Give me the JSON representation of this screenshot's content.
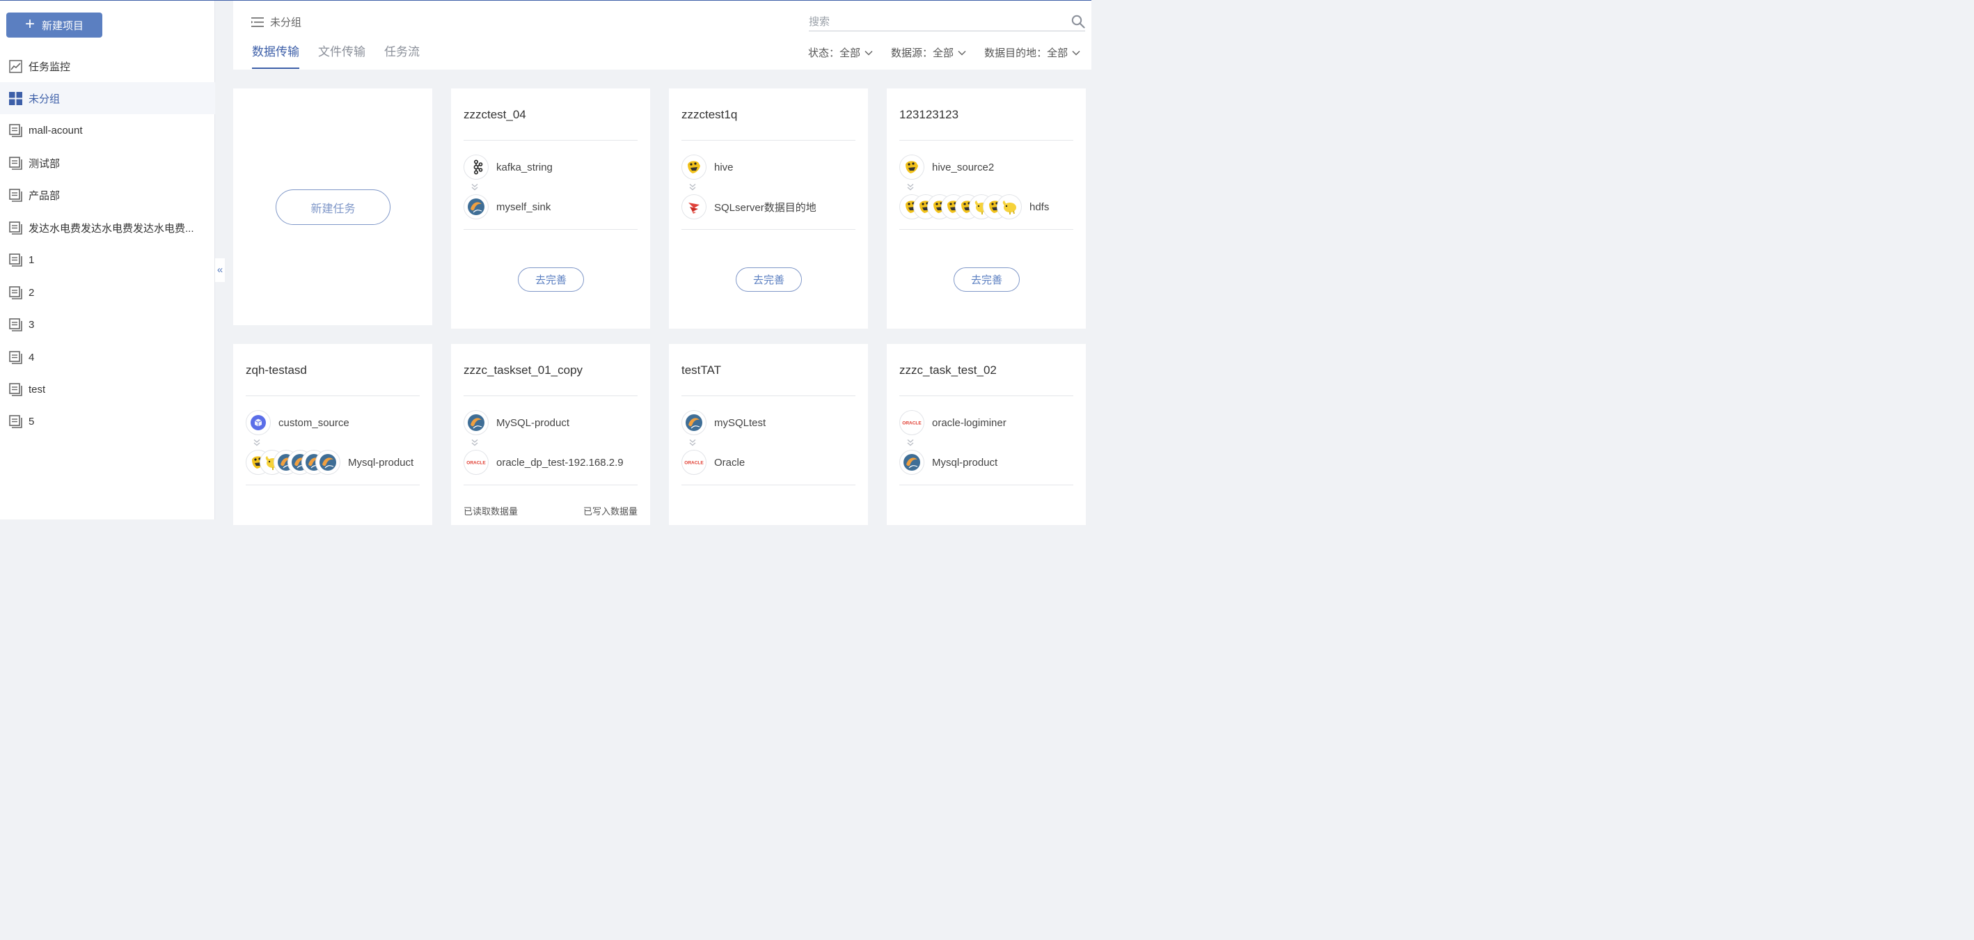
{
  "sidebar": {
    "new_project": "新建项目",
    "items": [
      {
        "label": "任务监控",
        "icon": "chart-icon"
      },
      {
        "label": "未分组",
        "icon": "grid-icon",
        "active": true
      },
      {
        "label": "mall-acount",
        "icon": "folder-icon"
      },
      {
        "label": "测试部",
        "icon": "folder-icon"
      },
      {
        "label": "产品部",
        "icon": "folder-icon"
      },
      {
        "label": "发达水电费发达水电费发达水电费...",
        "icon": "folder-icon"
      },
      {
        "label": "1",
        "icon": "folder-icon"
      },
      {
        "label": "2",
        "icon": "folder-icon"
      },
      {
        "label": "3",
        "icon": "folder-icon"
      },
      {
        "label": "4",
        "icon": "folder-icon"
      },
      {
        "label": "test",
        "icon": "folder-icon"
      },
      {
        "label": "5",
        "icon": "folder-icon"
      }
    ],
    "collapse": "«"
  },
  "header": {
    "group": "未分组",
    "tabs": [
      "数据传输",
      "文件传输",
      "任务流"
    ],
    "search_placeholder": "搜索",
    "filters": [
      {
        "label": "状态：",
        "value": "全部"
      },
      {
        "label": "数据源：",
        "value": "全部"
      },
      {
        "label": "数据目的地：",
        "value": "全部"
      }
    ]
  },
  "new_task": "新建任务",
  "perfect_label": "去完善",
  "cards": [
    {
      "title": "zzzctest_04",
      "source": {
        "label": "kafka_string",
        "icons": [
          "kafka-icon"
        ]
      },
      "target": {
        "label": "myself_sink",
        "icons": [
          "mysql-icon"
        ]
      }
    },
    {
      "title": "zzzctest1q",
      "source": {
        "label": "hive",
        "icons": [
          "hive-icon"
        ]
      },
      "target": {
        "label": "SQLserver数据目的地",
        "icons": [
          "sqlserver-icon"
        ]
      }
    },
    {
      "title": "123123123",
      "source": {
        "label": "hive_source2",
        "icons": [
          "hive-icon"
        ]
      },
      "target": {
        "label": "hdfs",
        "icons": [
          "hive-icon",
          "hive-icon",
          "hive-icon",
          "hive-icon",
          "hive-icon",
          "hadoop-icon",
          "hive-icon",
          "hadoop-icon"
        ]
      }
    },
    {
      "title": "zqh-testasd",
      "source": {
        "label": "custom_source",
        "icons": [
          "custom-icon"
        ]
      },
      "target": {
        "label": "Mysql-product",
        "icons": [
          "hive-icon",
          "hadoop-icon",
          "mysql-icon",
          "mysql-icon",
          "mysql-icon",
          "mysql-icon"
        ]
      }
    },
    {
      "title": "zzzc_taskset_01_copy",
      "source": {
        "label": "MySQL-product",
        "icons": [
          "mysql-icon"
        ]
      },
      "target": {
        "label": "oracle_dp_test-192.168.2.9",
        "icons": [
          "oracle-icon"
        ]
      }
    },
    {
      "title": "testTAT",
      "source": {
        "label": "mySQLtest",
        "icons": [
          "mysql-icon"
        ]
      },
      "target": {
        "label": "Oracle",
        "icons": [
          "oracle-icon"
        ]
      }
    },
    {
      "title": "zzzc_task_test_02",
      "source": {
        "label": "oracle-logiminer",
        "icons": [
          "oracle-icon"
        ]
      },
      "target": {
        "label": "Mysql-product",
        "icons": [
          "mysql-icon"
        ]
      }
    }
  ],
  "stats": {
    "read": "已读取数据量",
    "written": "已写入数据量"
  },
  "oracle_text": "ORACLE",
  "colors": {
    "accent": "#3d5fa8",
    "button": "#5b7fc1",
    "oracle": "#e03a2e",
    "hive": "#f2c21b",
    "mysql": "#3f6e96"
  }
}
